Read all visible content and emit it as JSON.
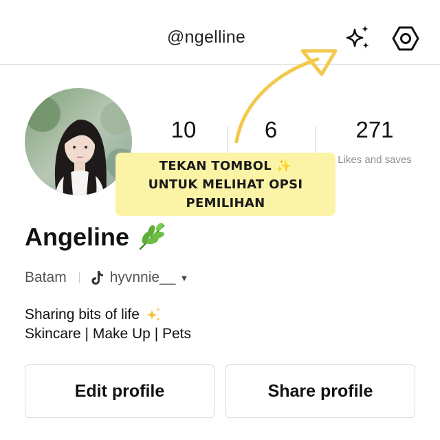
{
  "header": {
    "handle": "@ngelline",
    "sparkle_icon": "sparkle-icon",
    "settings_icon": "hexagon-settings-icon"
  },
  "profile": {
    "avatar_icon": "profile-photo",
    "name": "Angeline",
    "name_emoji": "herb-leaf-icon",
    "location": "Batam",
    "linked_account": "hyvnnie__",
    "linked_account_icon": "tiktok-icon",
    "bio": {
      "line1": "Sharing bits of life",
      "line1_emoji": "sparkles-icon",
      "line2": "Skincare | Make Up | Pets"
    }
  },
  "stats": {
    "following": {
      "value": "10",
      "label": ""
    },
    "followers": {
      "value": "6",
      "label": ""
    },
    "likes_saves": {
      "value": "271",
      "label": "Likes and saves"
    }
  },
  "tooltip": {
    "line1": "TEKAN TOMBOL ✨",
    "line2": "UNTUK MELIHAT OPSI",
    "line3": "PEMILIHAN"
  },
  "buttons": {
    "edit_profile": "Edit profile",
    "share_profile": "Share profile"
  },
  "colors": {
    "tooltip_bg": "#fbf3a6",
    "arrow": "#f2c94c",
    "border": "#dcdcdc",
    "muted_text": "#8e8e8e"
  }
}
